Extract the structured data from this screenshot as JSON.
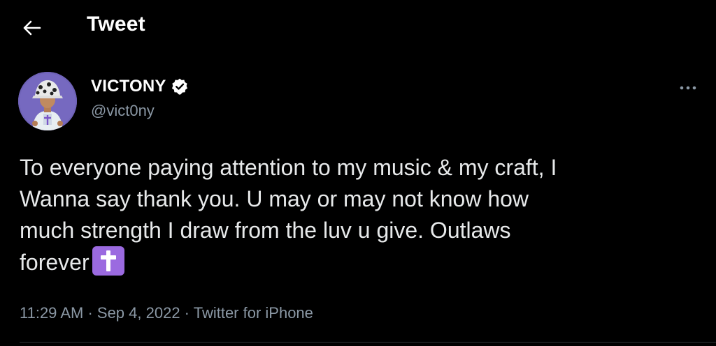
{
  "header": {
    "title": "Tweet",
    "back_icon": "arrow-left-icon"
  },
  "author": {
    "display_name": "VICTONY",
    "handle": "@vict0ny",
    "verified_icon": "verified-badge-icon",
    "avatar": "user-avatar"
  },
  "tweet": {
    "text": "To everyone paying attention to my music & my craft, I\nWanna say thank you. U may or may not know how\nmuch strength I draw from the luv u give. Outlaws\nforever",
    "emoji": "latin-cross-emoji",
    "time": "11:29 AM",
    "sep1": " · ",
    "date": "Sep 4, 2022",
    "sep2": " · ",
    "source": "Twitter for iPhone"
  },
  "more_icon": "more-horizontal-icon",
  "colors": {
    "background": "#000000",
    "text": "#e7e9ea",
    "secondary": "#8b98a5",
    "emoji_bg": "#9b6ae0"
  }
}
